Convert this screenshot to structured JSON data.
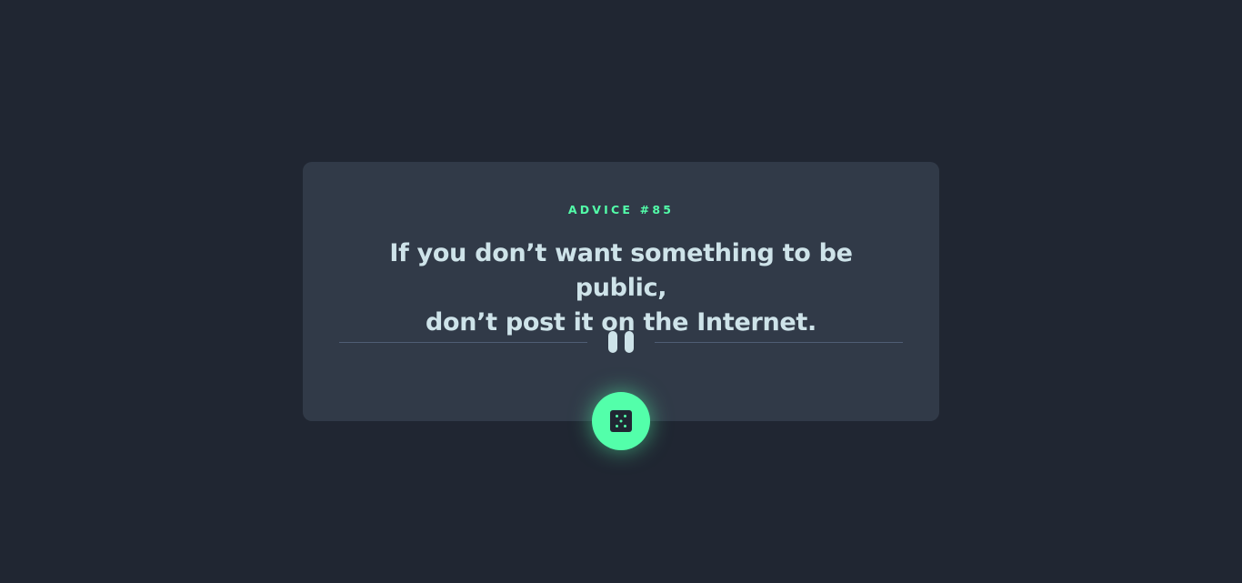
{
  "card": {
    "advice_label": "ADVICE #85",
    "quote_line1": "If you don’t want something to be public,",
    "quote_line2": "don’t post it on the Internet."
  },
  "icons": {
    "divider": "pause-icon",
    "button": "dice-icon"
  },
  "colors": {
    "background": "#202632",
    "card": "#313a48",
    "accent": "#53ffaa",
    "text": "#cee3e9",
    "divider": "#4f5d74"
  }
}
